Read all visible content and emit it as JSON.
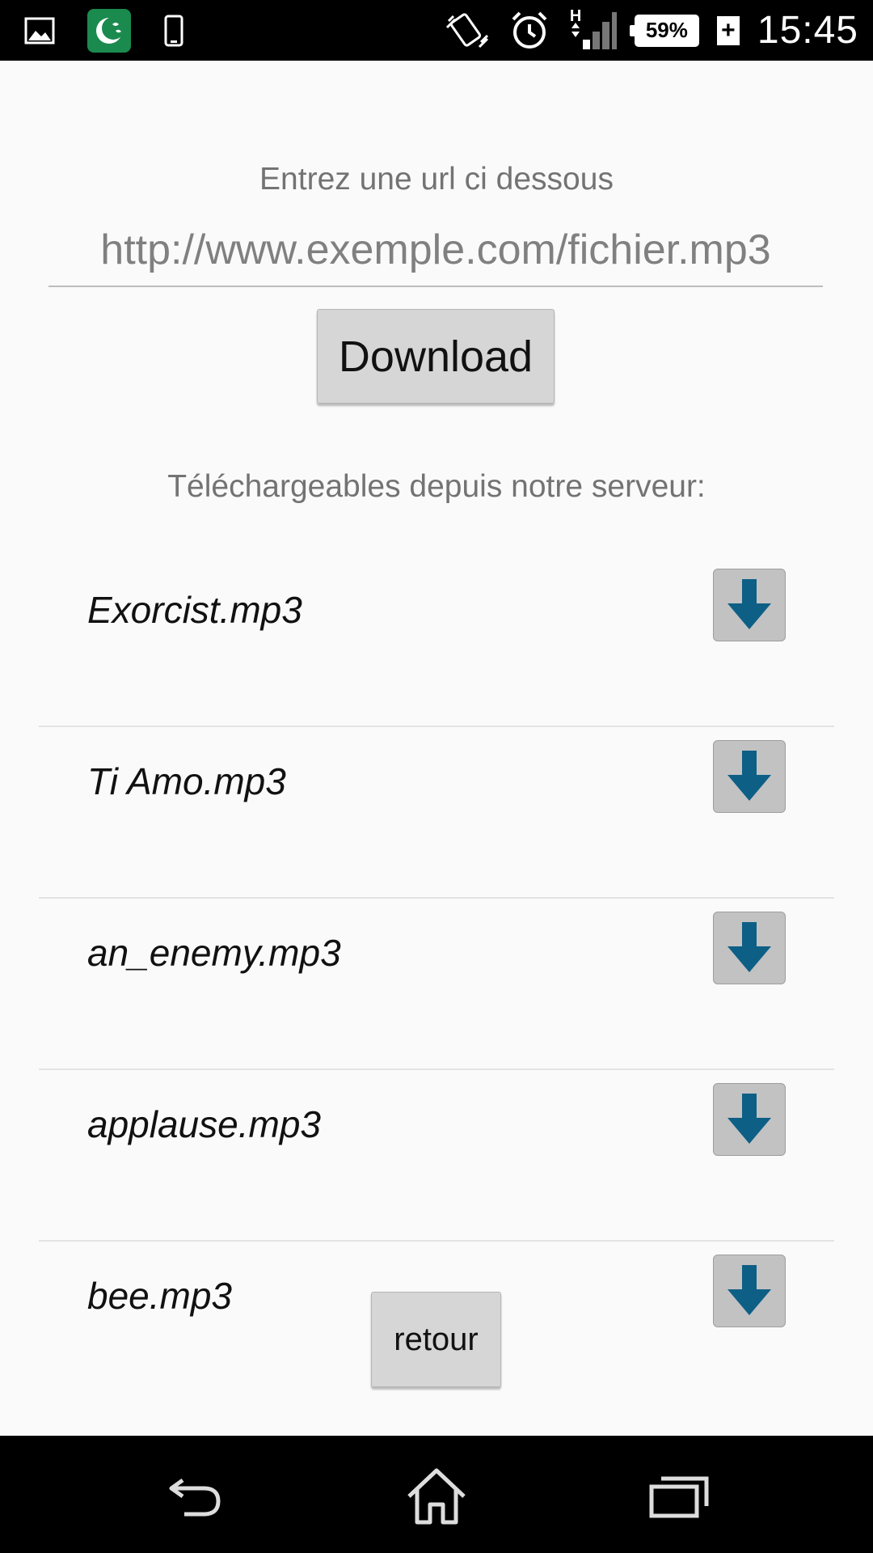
{
  "status_bar": {
    "icons_left": [
      "image-icon",
      "app-icon",
      "phone-icon"
    ],
    "icons_right": [
      "vibrate-icon",
      "alarm-icon",
      "signal-icon"
    ],
    "network_type": "H",
    "battery_percent": "59%",
    "charging_symbol": "+",
    "time": "15:45"
  },
  "form": {
    "prompt_label": "Entrez une url ci dessous",
    "url_placeholder": "http://www.exemple.com/fichier.mp3",
    "download_label": "Download"
  },
  "server": {
    "section_label": "Téléchargeables depuis notre serveur:",
    "files": [
      {
        "name": "Exorcist.mp3"
      },
      {
        "name": "Ti Amo.mp3"
      },
      {
        "name": "an_enemy.mp3"
      },
      {
        "name": "applause.mp3"
      },
      {
        "name": "bee.mp3"
      }
    ]
  },
  "back_label": "retour",
  "navigation": {
    "icons": [
      "back-icon",
      "home-icon",
      "recents-icon"
    ]
  },
  "colors": {
    "arrow_accent": "#0d5f86",
    "app_badge": "#1b8a4e"
  }
}
